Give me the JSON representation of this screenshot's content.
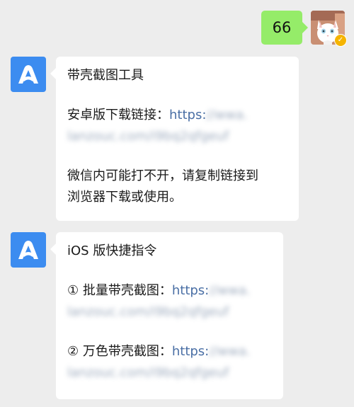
{
  "chat": {
    "outgoing": {
      "text": "66"
    },
    "message1": {
      "title": "带壳截图工具",
      "android_label": "安卓版下载链接：",
      "link_prefix": "https:",
      "link_blur_1": "//wwa.",
      "link_blur_2": "lanzouc.com/i9bq2qfgeuf",
      "note_line1": "微信内可能打不开，请复制链接到",
      "note_line2": "浏览器下载或使用。"
    },
    "message2": {
      "title": "iOS 版快捷指令",
      "item1_label": "① 批量带壳截图：",
      "item1_prefix": "https:",
      "item1_blur_1": "//wwa.",
      "item1_blur_2": "lanzouc.com/i9bq2qfgeuf",
      "item2_label": "② 万色带壳截图：",
      "item2_prefix": "https:",
      "item2_blur_1": "//wwa.",
      "item2_blur_2": "lanzouc.com/i9bq2qfgeuf"
    }
  },
  "icons": {
    "bot_avatar": "app-logo-icon",
    "user_avatar": "cat-avatar",
    "verified": "verified-badge-icon"
  },
  "colors": {
    "background": "#ededed",
    "outgoing_bubble": "#95ec69",
    "incoming_bubble": "#ffffff",
    "bot_avatar": "#3c8cf0",
    "link": "#4a6fa5",
    "badge": "#f5b400"
  }
}
